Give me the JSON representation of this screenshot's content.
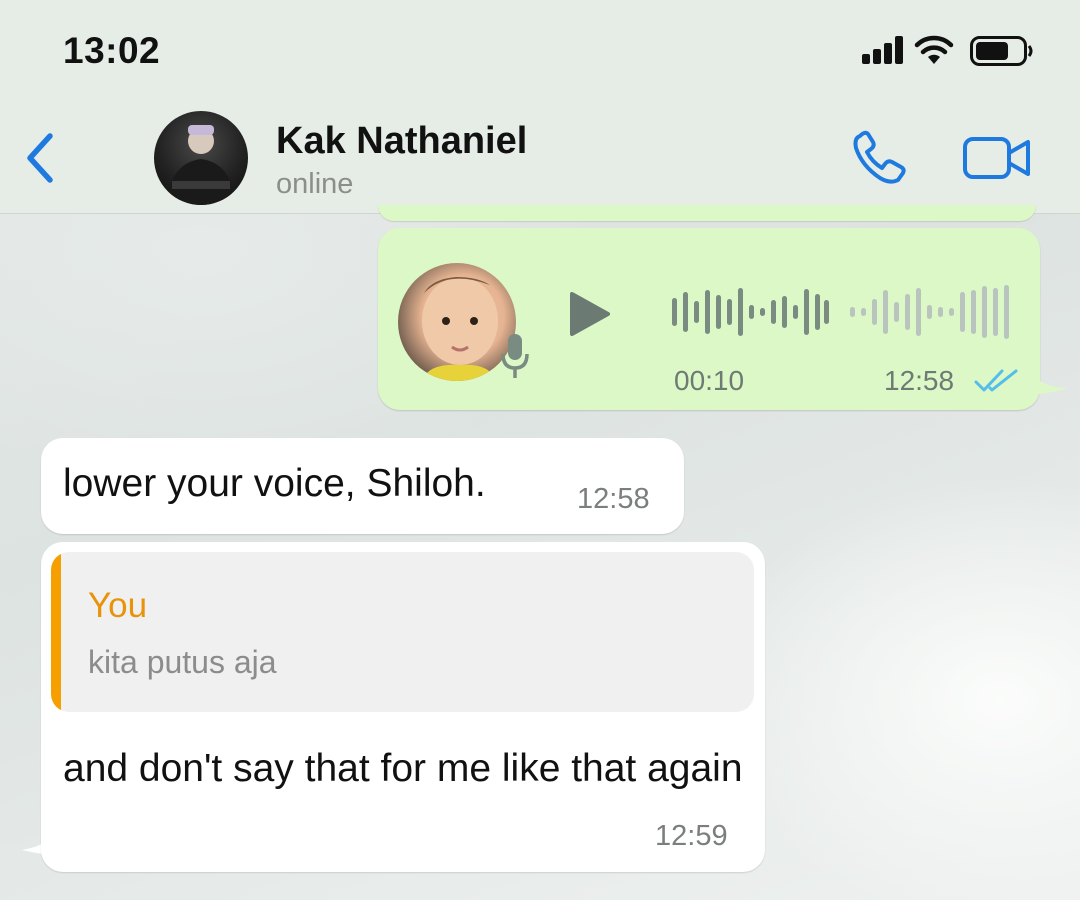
{
  "status_bar": {
    "time": "13:02"
  },
  "header": {
    "contact_name": "Kak Nathaniel",
    "contact_status": "online"
  },
  "messages": [
    {
      "type": "voice",
      "direction": "outgoing",
      "duration": "00:10",
      "time": "12:58",
      "read": true
    },
    {
      "type": "text",
      "direction": "incoming",
      "text": "lower your voice, Shiloh.",
      "time": "12:58"
    },
    {
      "type": "reply",
      "direction": "incoming",
      "quote_author": "You",
      "quote_text": "kita putus aja",
      "text": "and don't say that for me like that again",
      "time": "12:59"
    }
  ],
  "colors": {
    "accent_blue": "#1f7ae0",
    "outgoing_bubble": "#dcf8c6",
    "incoming_bubble": "#ffffff",
    "quote_accent": "#f59f00",
    "read_ticks": "#53bdeb"
  },
  "icons": [
    "back-chevron-icon",
    "phone-icon",
    "video-camera-icon",
    "play-icon",
    "microphone-icon",
    "double-check-icon",
    "signal-icon",
    "wifi-icon",
    "battery-icon"
  ]
}
